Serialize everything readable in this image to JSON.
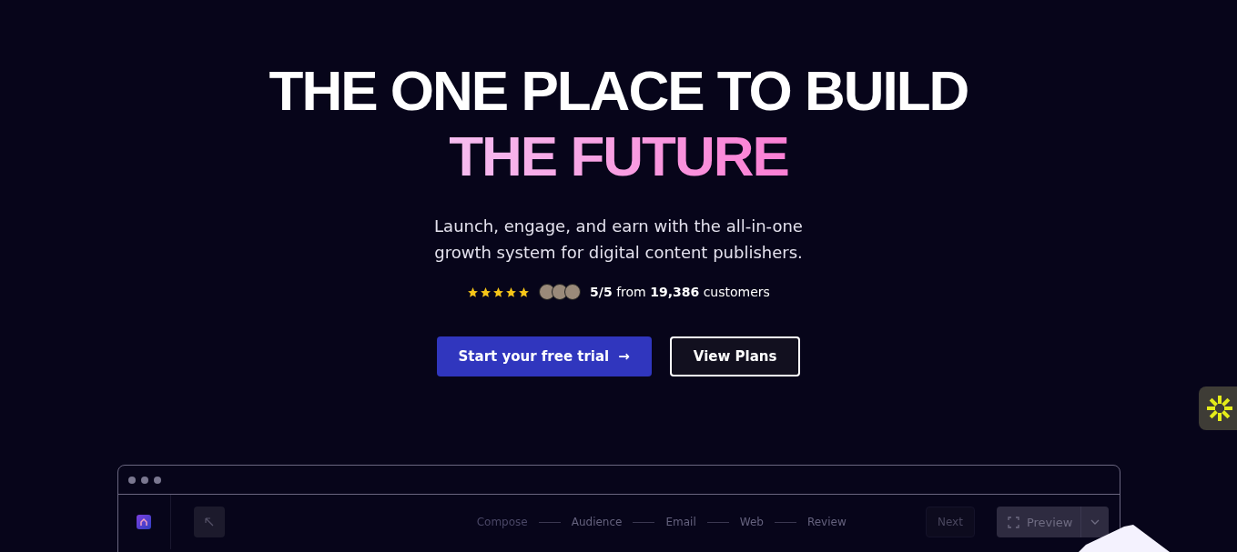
{
  "hero": {
    "title_line_1": "THE ONE PLACE TO BUILD",
    "title_line_2": "THE FUTURE",
    "subtitle": "Launch, engage, and earn with the all-in-one growth system for digital content publishers."
  },
  "rating": {
    "stars": 5,
    "text": "**5/5** from **19,386** customers"
  },
  "buttons": [
    {
      "label": "Start your free trial",
      "kind": "primary",
      "arrow": "→"
    },
    {
      "label": "View Plans",
      "kind": "outline"
    }
  ],
  "app_preview": {
    "steps": [
      {
        "label": "Compose",
        "faded": true
      },
      {
        "label": "Audience",
        "faded": false
      },
      {
        "label": "Email",
        "faded": false
      },
      {
        "label": "Web",
        "faded": false
      },
      {
        "label": "Review",
        "faded": false
      }
    ],
    "next_button": "Next",
    "preview_button": "Preview"
  }
}
